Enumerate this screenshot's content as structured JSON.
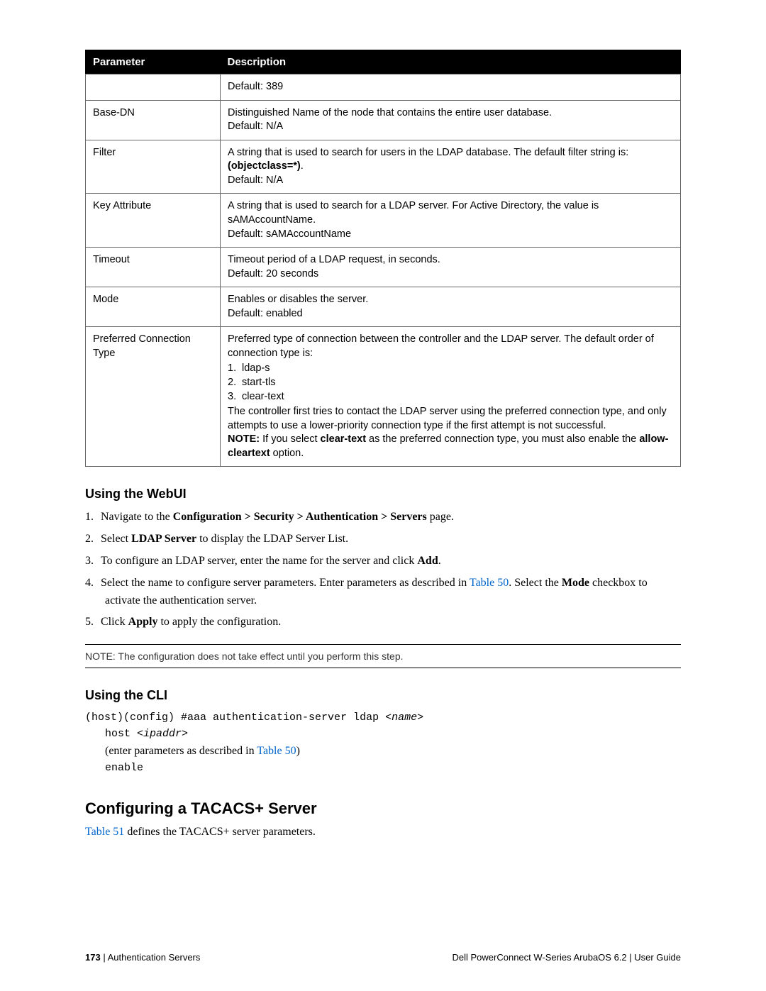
{
  "table": {
    "headers": {
      "param": "Parameter",
      "desc": "Description"
    },
    "rows": {
      "r0": {
        "param": "",
        "desc": "Default: 389"
      },
      "r1": {
        "param": "Base-DN",
        "desc_line1": "Distinguished Name of the node that contains the entire user database.",
        "desc_line2": "Default: N/A"
      },
      "r2": {
        "param": "Filter",
        "desc_line1": "A string that is used to search for users in the LDAP database. The default filter string is:",
        "desc_line2_strong": "(objectclass=*)",
        "desc_line2_tail": ".",
        "desc_line3": "Default: N/A"
      },
      "r3": {
        "param": "Key Attribute",
        "desc_line1": "A string that is used to search for a LDAP server. For Active Directory, the value is sAMAccountName.",
        "desc_line2": "Default: sAMAccountName"
      },
      "r4": {
        "param": "Timeout",
        "desc_line1": "Timeout period of a LDAP request, in seconds.",
        "desc_line2": "Default: 20 seconds"
      },
      "r5": {
        "param": "Mode",
        "desc_line1": "Enables or disables the server.",
        "desc_line2": "Default: enabled"
      },
      "r6": {
        "param": "Preferred Connection Type",
        "desc_line1": "Preferred type of connection between the controller and the LDAP server. The default order of connection type is:",
        "items": {
          "i1_num": "1.",
          "i1_txt": "ldap-s",
          "i2_num": "2.",
          "i2_txt": "start-tls",
          "i3_num": "3.",
          "i3_txt": "clear-text"
        },
        "desc_line2": "The controller first tries to contact the LDAP server using the preferred connection type, and only attempts to use a lower-priority connection type if the first attempt is not successful.",
        "note_strong1": "NOTE:",
        "note_txt1": " If you select ",
        "note_strong2": "clear-text",
        "note_txt2": " as the preferred connection type, you must also enable the ",
        "note_strong3": "allow-cleartext",
        "note_txt3": " option."
      }
    }
  },
  "webui": {
    "heading": "Using the WebUI",
    "steps": {
      "s1_num": "1.",
      "s1_a": "Navigate to the ",
      "s1_b": "Configuration > Security > Authentication > Servers",
      "s1_c": " page.",
      "s2_num": "2.",
      "s2_a": "Select ",
      "s2_b": "LDAP Server",
      "s2_c": " to display the LDAP Server List.",
      "s3_num": "3.",
      "s3_a": "To configure an LDAP server, enter the name for the server and click ",
      "s3_b": "Add",
      "s3_c": ".",
      "s4_num": "4.",
      "s4_a": "Select the name to configure server parameters. Enter parameters as described in ",
      "s4_link": "Table 50",
      "s4_b": ". Select the ",
      "s4_c": "Mode",
      "s4_d": " checkbox to activate the authentication server.",
      "s5_num": "5.",
      "s5_a": "Click ",
      "s5_b": "Apply",
      "s5_c": " to apply the configuration."
    },
    "note": "NOTE: The configuration does not take effect until you perform this step."
  },
  "cli": {
    "heading": "Using the CLI",
    "line1_a": "(host)(config) #aaa authentication-server ldap ",
    "line1_b": "<name>",
    "line2_a": "host ",
    "line2_b": "<ipaddr>",
    "paren_a": "(enter parameters as described in ",
    "paren_link": "Table 50",
    "paren_b": ")",
    "line3": "enable"
  },
  "tacacs": {
    "heading": "Configuring a TACACS+ Server",
    "para_link": "Table 51",
    "para_txt": " defines the TACACS+ server parameters."
  },
  "footer": {
    "page": "173",
    "sep": " | ",
    "left": "Authentication Servers",
    "right": "Dell PowerConnect W-Series ArubaOS 6.2  |  User Guide"
  }
}
